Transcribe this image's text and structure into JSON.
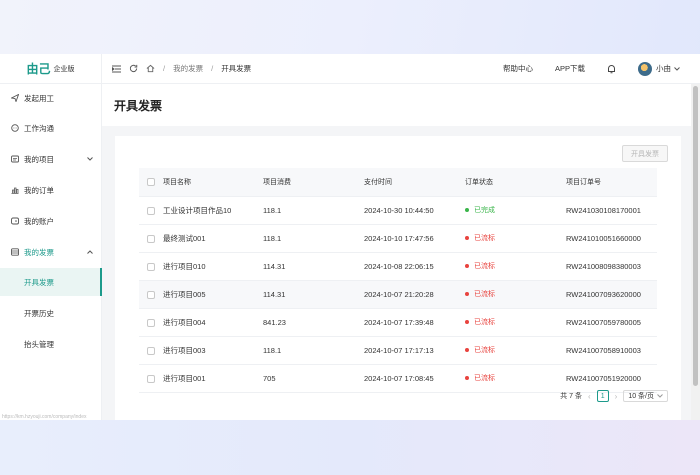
{
  "brand": {
    "name": "由己",
    "edition": "企业版",
    "color": "#1d9a8b"
  },
  "breadcrumb": {
    "parent": "我的发票",
    "separator": "/",
    "current": "开具发票"
  },
  "header": {
    "help": "帮助中心",
    "app": "APP下载",
    "user": "小由"
  },
  "sidebar": {
    "items": [
      {
        "label": "发起用工",
        "icon": "send-icon"
      },
      {
        "label": "工作沟通",
        "icon": "chat-icon"
      },
      {
        "label": "我的项目",
        "icon": "project-icon",
        "chevron": "chevron-down-icon"
      },
      {
        "label": "我的订单",
        "icon": "order-icon"
      },
      {
        "label": "我的账户",
        "icon": "account-icon"
      },
      {
        "label": "我的发票",
        "icon": "invoice-icon",
        "chevron": "chevron-up-icon"
      }
    ],
    "sub": [
      "开具发票",
      "开票历史",
      "抬头管理"
    ],
    "footer": "https://km.hzyouji.com/company/index"
  },
  "page": {
    "title": "开具发票",
    "issue_button": "开具发票"
  },
  "table": {
    "headers": [
      "项目名称",
      "项目消费",
      "支付时间",
      "订单状态",
      "项目订单号"
    ],
    "rows": [
      {
        "name": "工业设计项目作品10",
        "amount": "118.1",
        "time": "2024-10-30 10:44:50",
        "status": "已完成",
        "status_color": "#3ab54a",
        "order": "RW241030108170001"
      },
      {
        "name": "最终测试001",
        "amount": "118.1",
        "time": "2024-10-10 17:47:56",
        "status": "已流标",
        "status_color": "#e8433e",
        "order": "RW241010051660000"
      },
      {
        "name": "进行项目010",
        "amount": "114.31",
        "time": "2024-10-08 22:06:15",
        "status": "已流标",
        "status_color": "#e8433e",
        "order": "RW241008098380003"
      },
      {
        "name": "进行项目005",
        "amount": "114.31",
        "time": "2024-10-07 21:20:28",
        "status": "已流标",
        "status_color": "#e8433e",
        "order": "RW241007093620000"
      },
      {
        "name": "进行项目004",
        "amount": "841.23",
        "time": "2024-10-07 17:39:48",
        "status": "已流标",
        "status_color": "#e8433e",
        "order": "RW241007059780005"
      },
      {
        "name": "进行项目003",
        "amount": "118.1",
        "time": "2024-10-07 17:17:13",
        "status": "已流标",
        "status_color": "#e8433e",
        "order": "RW241007058910003"
      },
      {
        "name": "进行项目001",
        "amount": "705",
        "time": "2024-10-07 17:08:45",
        "status": "已流标",
        "status_color": "#e8433e",
        "order": "RW241007051920000"
      }
    ]
  },
  "pagination": {
    "total": "共 7 条",
    "current": "1",
    "page_size": "10 条/页"
  }
}
